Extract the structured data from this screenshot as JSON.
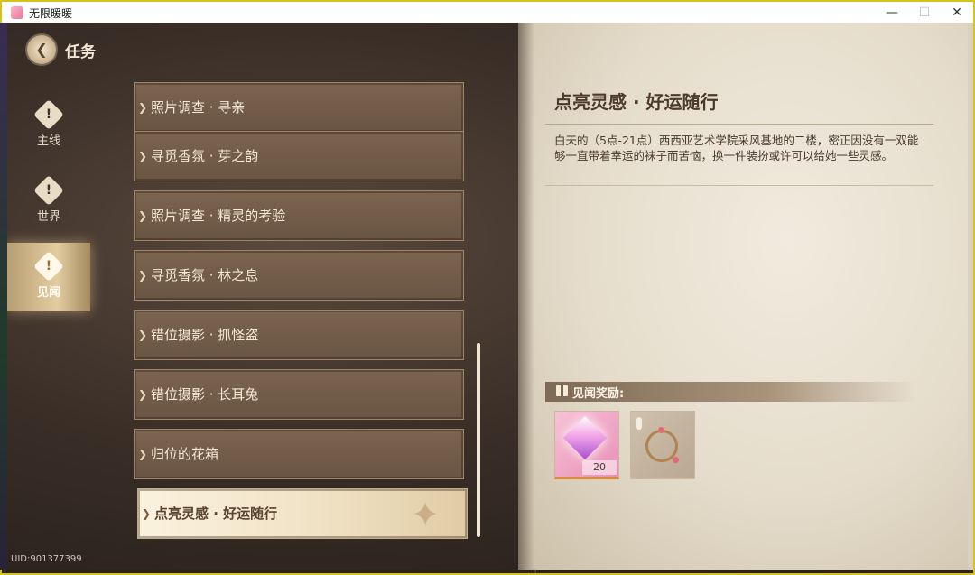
{
  "window": {
    "title": "无限暖暖",
    "minimize": "—",
    "maximize": "☐",
    "close": "✕"
  },
  "nav": {
    "title": "任务",
    "items": [
      {
        "label": "主线",
        "icon": "exclamation-diamond-icon",
        "glyph": "!"
      },
      {
        "label": "世界",
        "icon": "exclamation-diamond-icon",
        "glyph": "!"
      },
      {
        "label": "见闻",
        "icon": "exclamation-diamond-icon",
        "glyph": "!",
        "active": true
      }
    ]
  },
  "quests": [
    {
      "title": "照片调查 · 寻亲"
    },
    {
      "title": "寻觅香氛 · 芽之韵"
    },
    {
      "title": "照片调查 · 精灵的考验"
    },
    {
      "title": "寻觅香氛 · 林之息"
    },
    {
      "title": "错位摄影 · 抓怪盗"
    },
    {
      "title": "错位摄影 · 长耳兔"
    },
    {
      "title": "归位的花箱"
    },
    {
      "title": "点亮灵感 · 好运随行",
      "selected": true
    }
  ],
  "detail": {
    "title": "点亮灵感 · 好运随行",
    "description": "白天的（5点-21点）西西亚艺术学院采风基地的二楼，密正因没有一双能够一直带着幸运的袜子而苦恼，换一件装扮或许可以给她一些灵感。",
    "reward_label": "见闻奖励:",
    "rewards": [
      {
        "icon": "pink-crystal-icon",
        "count": "20"
      },
      {
        "icon": "bracelet-icon",
        "count": ""
      }
    ]
  },
  "footer": {
    "uid": "UID:901377399"
  },
  "colors": {
    "frame": "#d7c21a",
    "panel": "#e5dccb",
    "active_nav": "#e3cda0"
  }
}
